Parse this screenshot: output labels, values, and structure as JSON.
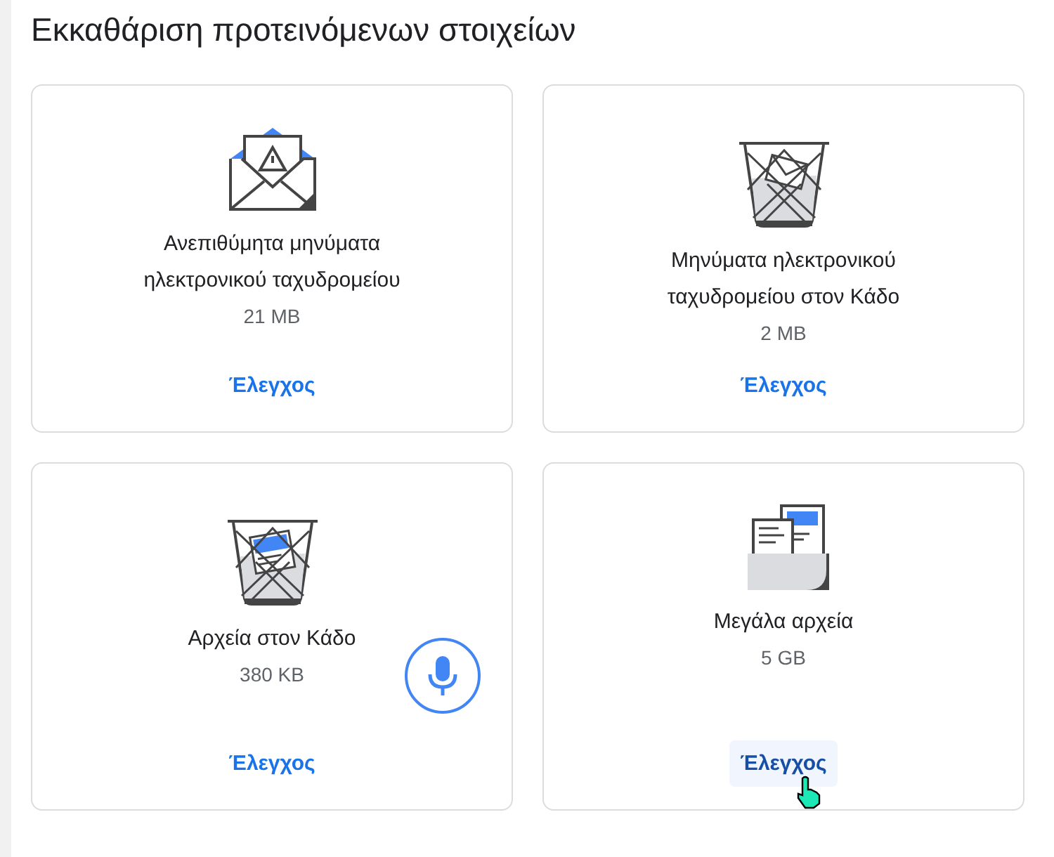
{
  "title": "Εκκαθάριση προτεινόμενων στοιχείων",
  "cards": [
    {
      "kind": "spam",
      "title": "Ανεπιθύμητα μηνύματα ηλεκτρονικού ταχυδρομείου",
      "size": "21 MB",
      "action": "Έλεγχος",
      "hovered": false
    },
    {
      "kind": "trash-mail",
      "title": "Μηνύματα ηλεκτρονικού ταχυδρομείου στον Κάδο",
      "size": "2 MB",
      "action": "Έλεγχος",
      "hovered": false
    },
    {
      "kind": "trash-files",
      "title": "Αρχεία στον Κάδο",
      "size": "380 KB",
      "action": "Έλεγχος",
      "hovered": false
    },
    {
      "kind": "large-files",
      "title": "Μεγάλα αρχεία",
      "size": "5 GB",
      "action": "Έλεγχος",
      "hovered": true
    }
  ]
}
